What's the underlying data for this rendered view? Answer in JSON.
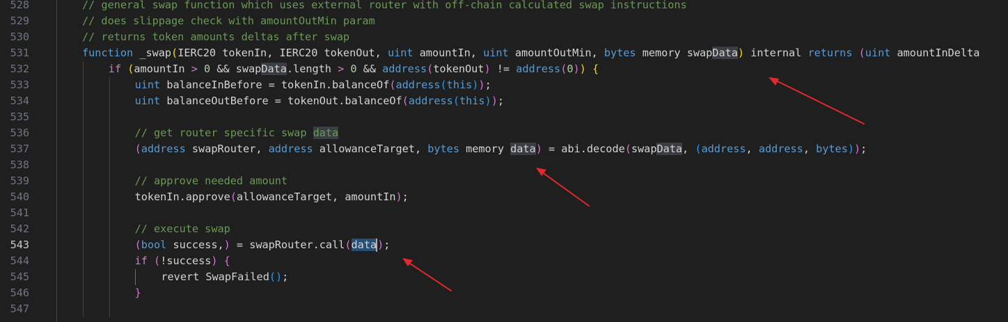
{
  "gutter": {
    "line_numbers": [
      "528",
      "529",
      "530",
      "531",
      "532",
      "533",
      "534",
      "535",
      "536",
      "537",
      "538",
      "539",
      "540",
      "541",
      "542",
      "543",
      "544",
      "545",
      "546",
      "547"
    ],
    "active_line": "543"
  },
  "code": {
    "lines": [
      {
        "indent": 1,
        "tokens": [
          [
            "// general swap function which uses external router with off-chain calculated swap instructions",
            "com"
          ]
        ]
      },
      {
        "indent": 1,
        "tokens": [
          [
            "// does slippage check with amountOutMin param",
            "com"
          ]
        ]
      },
      {
        "indent": 1,
        "tokens": [
          [
            "// returns token amounts deltas after swap",
            "com"
          ]
        ]
      },
      {
        "indent": 1,
        "tokens": [
          [
            "function",
            "kw"
          ],
          [
            " _swap",
            "fn"
          ],
          [
            "(",
            "p1"
          ],
          [
            "IERC20 tokenIn, IERC20 tokenOut, ",
            "plain"
          ],
          [
            "uint",
            "kw"
          ],
          [
            " amountIn, ",
            "plain"
          ],
          [
            "uint",
            "kw"
          ],
          [
            " amountOutMin, ",
            "plain"
          ],
          [
            "bytes",
            "kw"
          ],
          [
            " memory swap",
            "plain"
          ],
          [
            "Data",
            "hl"
          ],
          [
            ")",
            "p1"
          ],
          [
            " internal ",
            "plain"
          ],
          [
            "returns",
            "kw"
          ],
          [
            " ",
            "plain"
          ],
          [
            "(",
            "p2"
          ],
          [
            "uint",
            "kw"
          ],
          [
            " amountInDelta",
            "plain"
          ]
        ]
      },
      {
        "indent": 2,
        "tokens": [
          [
            "if",
            "ctl"
          ],
          [
            " ",
            "plain"
          ],
          [
            "(",
            "p1"
          ],
          [
            "amountIn ",
            "plain"
          ],
          [
            ">",
            "ctl"
          ],
          [
            " ",
            "plain"
          ],
          [
            "0",
            "num"
          ],
          [
            " && swap",
            "plain"
          ],
          [
            "Data",
            "hl"
          ],
          [
            ".length ",
            "plain"
          ],
          [
            ">",
            "ctl"
          ],
          [
            " ",
            "plain"
          ],
          [
            "0",
            "num"
          ],
          [
            " && ",
            "plain"
          ],
          [
            "address",
            "kw"
          ],
          [
            "(",
            "p2"
          ],
          [
            "tokenOut",
            "plain"
          ],
          [
            ")",
            "p2"
          ],
          [
            " != ",
            "plain"
          ],
          [
            "address",
            "kw"
          ],
          [
            "(",
            "p2"
          ],
          [
            "0",
            "num"
          ],
          [
            ")",
            "p2"
          ],
          [
            ")",
            "p1"
          ],
          [
            " ",
            "plain"
          ],
          [
            "{",
            "p1"
          ]
        ]
      },
      {
        "indent": 3,
        "tokens": [
          [
            "uint",
            "kw"
          ],
          [
            " balanceInBefore = tokenIn.balanceOf",
            "plain"
          ],
          [
            "(",
            "p2"
          ],
          [
            "address",
            "kw"
          ],
          [
            "(",
            "p3"
          ],
          [
            "this",
            "kw"
          ],
          [
            ")",
            "p3"
          ],
          [
            ")",
            "p2"
          ],
          [
            ";",
            "plain"
          ]
        ]
      },
      {
        "indent": 3,
        "tokens": [
          [
            "uint",
            "kw"
          ],
          [
            " balanceOutBefore = tokenOut.balanceOf",
            "plain"
          ],
          [
            "(",
            "p2"
          ],
          [
            "address",
            "kw"
          ],
          [
            "(",
            "p3"
          ],
          [
            "this",
            "kw"
          ],
          [
            ")",
            "p3"
          ],
          [
            ")",
            "p2"
          ],
          [
            ";",
            "plain"
          ]
        ]
      },
      {
        "indent": 3,
        "tokens": []
      },
      {
        "indent": 3,
        "tokens": [
          [
            "// get router specific swap ",
            "com"
          ],
          [
            "data",
            "comhl"
          ]
        ]
      },
      {
        "indent": 3,
        "tokens": [
          [
            "(",
            "p2"
          ],
          [
            "address",
            "kw"
          ],
          [
            " swapRouter, ",
            "plain"
          ],
          [
            "address",
            "kw"
          ],
          [
            " allowanceTarget, ",
            "plain"
          ],
          [
            "bytes",
            "kw"
          ],
          [
            " memory ",
            "plain"
          ],
          [
            "data",
            "hl"
          ],
          [
            ")",
            "p2"
          ],
          [
            " = abi.decode",
            "plain"
          ],
          [
            "(",
            "p2"
          ],
          [
            "swap",
            "plain"
          ],
          [
            "Data",
            "hl"
          ],
          [
            ", ",
            "plain"
          ],
          [
            "(",
            "p3"
          ],
          [
            "address",
            "kw"
          ],
          [
            ", ",
            "plain"
          ],
          [
            "address",
            "kw"
          ],
          [
            ", ",
            "plain"
          ],
          [
            "bytes",
            "kw"
          ],
          [
            ")",
            "p3"
          ],
          [
            ")",
            "p2"
          ],
          [
            ";",
            "plain"
          ]
        ]
      },
      {
        "indent": 3,
        "tokens": []
      },
      {
        "indent": 3,
        "tokens": [
          [
            "// approve needed amount",
            "com"
          ]
        ]
      },
      {
        "indent": 3,
        "tokens": [
          [
            "tokenIn.approve",
            "plain"
          ],
          [
            "(",
            "p2"
          ],
          [
            "allowanceTarget, amountIn",
            "plain"
          ],
          [
            ")",
            "p2"
          ],
          [
            ";",
            "plain"
          ]
        ]
      },
      {
        "indent": 3,
        "tokens": []
      },
      {
        "indent": 3,
        "tokens": [
          [
            "// execute swap",
            "com"
          ]
        ]
      },
      {
        "indent": 3,
        "tokens": [
          [
            "(",
            "p2"
          ],
          [
            "bool",
            "kw"
          ],
          [
            " success,",
            "plain"
          ],
          [
            ")",
            "p2"
          ],
          [
            " = swapRouter.call",
            "plain"
          ],
          [
            "(",
            "p2"
          ],
          [
            "data",
            "hlsel"
          ],
          [
            "|",
            "cursor"
          ],
          [
            ")",
            "p2"
          ],
          [
            ";",
            "plain"
          ]
        ]
      },
      {
        "indent": 3,
        "tokens": [
          [
            "if",
            "ctl"
          ],
          [
            " ",
            "plain"
          ],
          [
            "(",
            "p2"
          ],
          [
            "!success",
            "plain"
          ],
          [
            ")",
            "p2"
          ],
          [
            " ",
            "plain"
          ],
          [
            "{",
            "p2"
          ]
        ]
      },
      {
        "indent": 4,
        "tokens": [
          [
            "revert SwapFailed",
            "plain"
          ],
          [
            "(",
            "p3"
          ],
          [
            ")",
            "p3"
          ],
          [
            ";",
            "plain"
          ]
        ]
      },
      {
        "indent": 3,
        "tokens": [
          [
            "}",
            "p2"
          ]
        ]
      },
      {
        "indent": 3,
        "tokens": []
      }
    ]
  },
  "colors": {
    "background": "#1f1f1f",
    "arrow": "#e0282d"
  }
}
